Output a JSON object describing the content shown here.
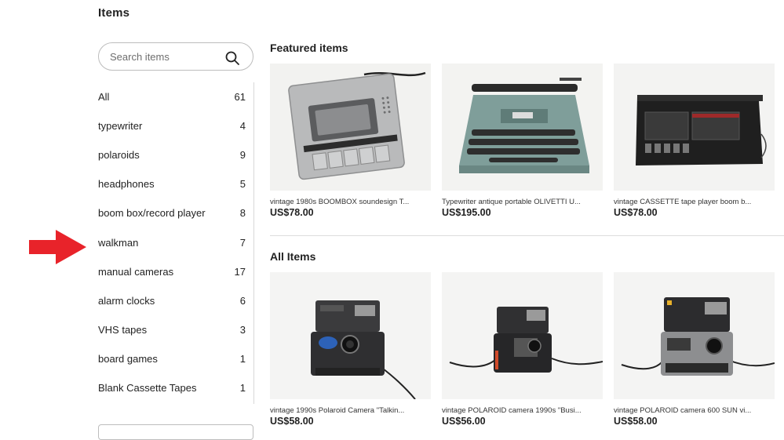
{
  "page": {
    "title": "Items"
  },
  "search": {
    "placeholder": "Search items",
    "icon": "search-icon"
  },
  "sidebar": {
    "items": [
      {
        "label": "All",
        "count": "61"
      },
      {
        "label": "typewriter",
        "count": "4"
      },
      {
        "label": "polaroids",
        "count": "9"
      },
      {
        "label": "headphones",
        "count": "5"
      },
      {
        "label": "boom box/record player",
        "count": "8"
      },
      {
        "label": "walkman",
        "count": "7"
      },
      {
        "label": "manual cameras",
        "count": "17"
      },
      {
        "label": "alarm clocks",
        "count": "6"
      },
      {
        "label": "VHS tapes",
        "count": "3"
      },
      {
        "label": "board games",
        "count": "1"
      },
      {
        "label": "Blank Cassette Tapes",
        "count": "1"
      }
    ]
  },
  "annotation": {
    "arrow_color": "#e8232a",
    "points_to": "walkman"
  },
  "featured": {
    "heading": "Featured items",
    "cards": [
      {
        "title": "vintage 1980s BOOMBOX soundesign T...",
        "price": "US$78.00",
        "icon": "cassette-recorder-photo"
      },
      {
        "title": "Typewriter antique portable OLIVETTI U...",
        "price": "US$195.00",
        "icon": "typewriter-photo"
      },
      {
        "title": "vintage CASSETTE tape player boom b...",
        "price": "US$78.00",
        "icon": "boombox-photo"
      }
    ]
  },
  "all_items": {
    "heading": "All Items",
    "cards": [
      {
        "title": "vintage 1990s Polaroid Camera \"Talkin...",
        "price": "US$58.00",
        "icon": "polaroid-camera-photo"
      },
      {
        "title": "vintage POLAROID camera 1990s \"Busi...",
        "price": "US$56.00",
        "icon": "polaroid-camera-photo"
      },
      {
        "title": "vintage POLAROID camera 600 SUN vi...",
        "price": "US$58.00",
        "icon": "polaroid-camera-photo"
      }
    ]
  }
}
